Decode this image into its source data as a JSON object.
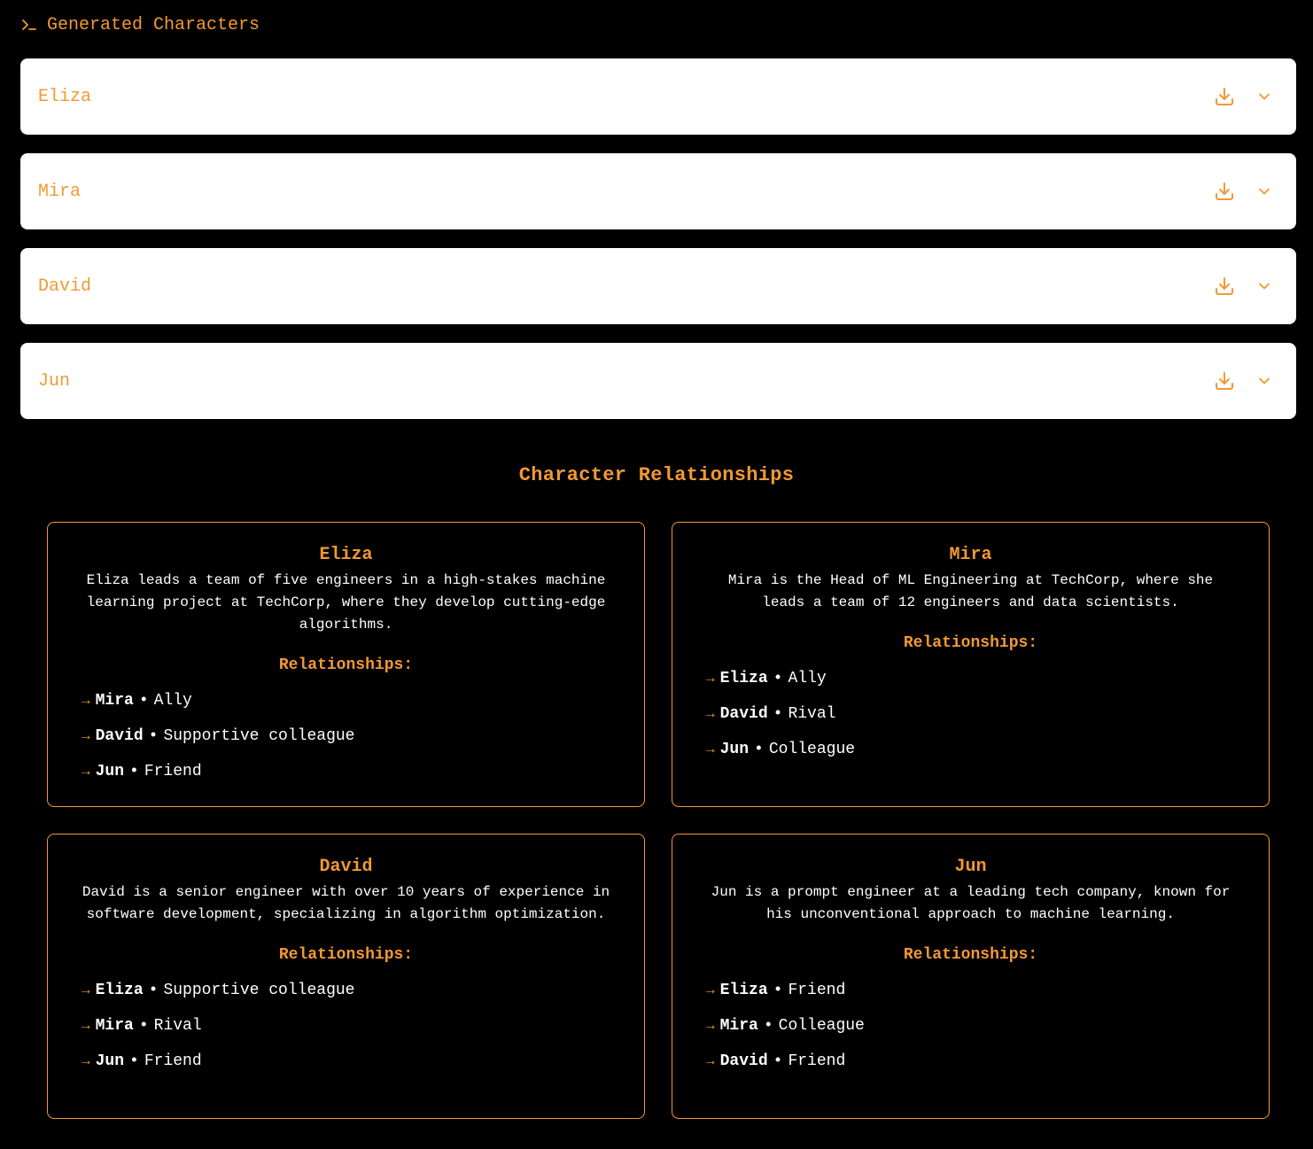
{
  "header": {
    "title": "Generated Characters",
    "icon": "terminal-prompt-icon"
  },
  "characters": [
    {
      "name": "Eliza"
    },
    {
      "name": "Mira"
    },
    {
      "name": "David"
    },
    {
      "name": "Jun"
    }
  ],
  "relationships_section": {
    "title": "Character Relationships",
    "heading": "Relationships:",
    "cards": [
      {
        "name": "Eliza",
        "description": "Eliza leads a team of five engineers in a high-stakes machine learning project at TechCorp, where they develop cutting-edge algorithms.",
        "relations": [
          {
            "name": "Mira",
            "type": "Ally"
          },
          {
            "name": "David",
            "type": "Supportive colleague"
          },
          {
            "name": "Jun",
            "type": "Friend"
          }
        ]
      },
      {
        "name": "Mira",
        "description": "Mira is the Head of ML Engineering at TechCorp, where she leads a team of 12 engineers and data scientists.",
        "relations": [
          {
            "name": "Eliza",
            "type": "Ally"
          },
          {
            "name": "David",
            "type": "Rival"
          },
          {
            "name": "Jun",
            "type": "Colleague"
          }
        ]
      },
      {
        "name": "David",
        "description": "David is a senior engineer with over 10 years of experience in software development, specializing in algorithm optimization.",
        "relations": [
          {
            "name": "Eliza",
            "type": "Supportive colleague"
          },
          {
            "name": "Mira",
            "type": "Rival"
          },
          {
            "name": "Jun",
            "type": "Friend"
          }
        ]
      },
      {
        "name": "Jun",
        "description": "Jun is a prompt engineer at a leading tech company, known for his unconventional approach to machine learning.",
        "relations": [
          {
            "name": "Eliza",
            "type": "Friend"
          },
          {
            "name": "Mira",
            "type": "Colleague"
          },
          {
            "name": "David",
            "type": "Friend"
          }
        ]
      }
    ]
  },
  "symbols": {
    "arrow": "→",
    "separator": "•"
  },
  "colors": {
    "accent": "#f29933",
    "background": "#000000",
    "panel": "#ffffff",
    "text": "#ffffff"
  }
}
